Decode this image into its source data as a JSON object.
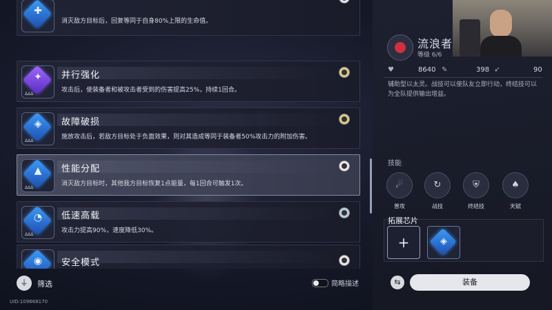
{
  "chips": [
    {
      "name": "",
      "desc": "消灭敌方目标后，回复等同于自身80%上限的生命值。",
      "icon": "chip-blue-icon",
      "badge": "dot"
    },
    {
      "name": "并行强化",
      "desc": "攻击后，使装备者和被攻击者受到的伤害提高25%，持续1回合。",
      "icon": "chip-purple-icon",
      "badge": "gold"
    },
    {
      "name": "故障破损",
      "desc": "施放攻击后，若敌方目标处于负面效果，则对其造成等同于装备者50%攻击力的附加伤害。",
      "icon": "chip-blue-icon",
      "badge": "gold"
    },
    {
      "name": "性能分配",
      "desc": "消灭敌方目标时，其他我方目标恢复1点能量，每1回合可触发1次。",
      "icon": "chip-blue-icon",
      "badge": "dot"
    },
    {
      "name": "低速高载",
      "desc": "攻击力提高90%，速度降低30%。",
      "icon": "chip-blue-icon",
      "badge": "x"
    },
    {
      "name": "安全模式",
      "desc": "",
      "icon": "chip-blue-icon",
      "badge": "dot"
    }
  ],
  "bottom_bar": {
    "filter_label": "筛选",
    "toggle_label": "简略描述",
    "uid": "UID:109668170"
  },
  "character": {
    "name": "流浪者",
    "level": "等级 6/6",
    "stats": {
      "hp": "8640",
      "atk": "398",
      "spd": "90"
    },
    "description": "辅助型以太灵。战技可以使队友立即行动，终结技可以为全队提供输出增益。"
  },
  "skills": {
    "title": "技能",
    "items": [
      {
        "label": "普攻",
        "icon": "normal-attack-icon"
      },
      {
        "label": "战技",
        "icon": "battle-skill-icon"
      },
      {
        "label": "终结技",
        "icon": "ultimate-icon"
      },
      {
        "label": "天赋",
        "icon": "talent-icon"
      }
    ]
  },
  "extension": {
    "title": "拓展芯片"
  },
  "equip_button": "装备",
  "colors": {
    "accent_blue": "#3e9bf4",
    "accent_purple": "#a06af8",
    "emblem_red": "#d03040"
  }
}
